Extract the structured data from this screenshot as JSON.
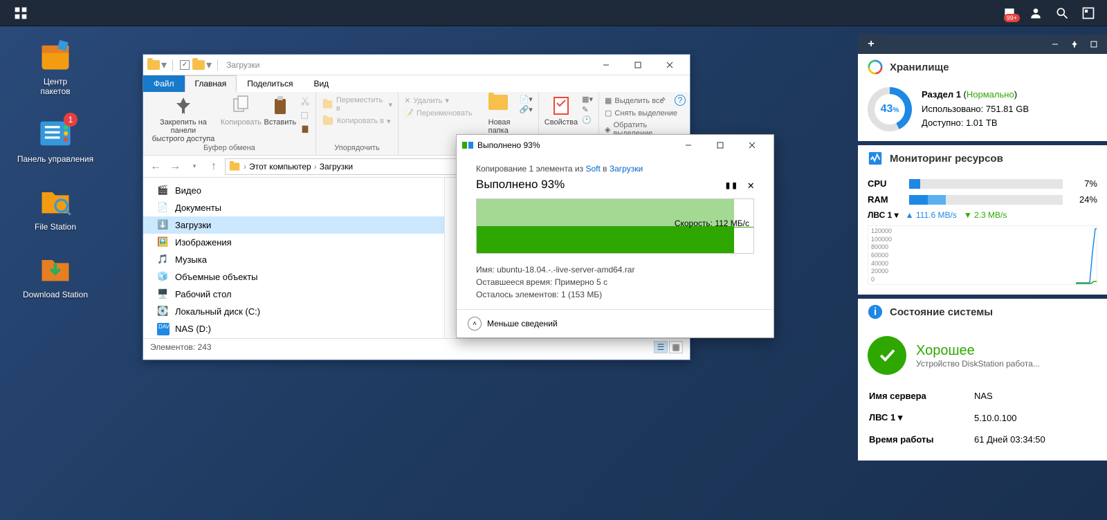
{
  "taskbar": {
    "notif_badge": "99+"
  },
  "desktop": {
    "icons": [
      {
        "label": "Центр\nпакетов"
      },
      {
        "label": "Панель управления",
        "badge": "1"
      },
      {
        "label": "File Station"
      },
      {
        "label": "Download Station"
      }
    ]
  },
  "explorer": {
    "window_title": "Загрузки",
    "tabs": {
      "file": "Файл",
      "home": "Главная",
      "share": "Поделиться",
      "view": "Вид"
    },
    "ribbon": {
      "pin": "Закрепить на панели\nбыстрого доступа",
      "copy": "Копировать",
      "paste": "Вставить",
      "group1": "Буфер обмена",
      "move_to": "Переместить в",
      "copy_to": "Копировать в",
      "delete": "Удалить",
      "rename": "Переименовать",
      "group2": "Упорядочить",
      "new_folder": "Новая\nпапка",
      "properties": "Свойства",
      "select_all": "Выделить все",
      "select_none": "Снять выделение",
      "invert": "Обратить выделение"
    },
    "nav": {
      "root": "Этот компьютер",
      "current": "Загрузки"
    },
    "tree": [
      "Видео",
      "Документы",
      "Загрузки",
      "Изображения",
      "Музыка",
      "Объемные объекты",
      "Рабочий стол",
      "Локальный диск (C:)",
      "NAS (D:)"
    ],
    "status": "Элементов: 243"
  },
  "copy_dialog": {
    "title": "Выполнено 93%",
    "desc_pre": "Копирование 1 элемента из ",
    "desc_src": "Soft",
    "desc_mid": " в ",
    "desc_dst": "Загрузки",
    "heading": "Выполнено 93%",
    "progress_pct": 93,
    "speed": "Скорость: 112 МБ/с",
    "name_label": "Имя:",
    "name_value": "ubuntu-18.04.-.-live-server-amd64.rar",
    "time_label": "Оставшееся время:",
    "time_value": "Примерно 5 с",
    "remain_label": "Осталось элементов:",
    "remain_value": "1 (153 МБ)",
    "less_details": "Меньше сведений"
  },
  "widgets": {
    "storage": {
      "title": "Хранилище",
      "pct": "43",
      "vol_label": "Раздел 1",
      "vol_status": "Нормально",
      "used_label": "Использовано:",
      "used_value": "751.81 GB",
      "avail_label": "Доступно:",
      "avail_value": "1.01 TB"
    },
    "monitor": {
      "title": "Мониторинг ресурсов",
      "cpu_label": "CPU",
      "cpu_pct": "7%",
      "cpu_val": 7,
      "ram_label": "RAM",
      "ram_pct": "24%",
      "ram_val": 24,
      "net_label": "ЛВС 1",
      "up": "111.6 MB/s",
      "dn": "2.3 MB/s",
      "y_ticks": [
        "120000",
        "100000",
        "80000",
        "60000",
        "40000",
        "20000",
        "0"
      ]
    },
    "health": {
      "title": "Состояние системы",
      "status": "Хорошее",
      "status_sub": "Устройство DiskStation работа...",
      "rows": [
        {
          "k": "Имя сервера",
          "v": "NAS"
        },
        {
          "k": "ЛВС 1",
          "v": "5.10.0.100",
          "dd": true
        },
        {
          "k": "Время работы",
          "v": "61 Дней 03:34:50"
        }
      ]
    }
  }
}
